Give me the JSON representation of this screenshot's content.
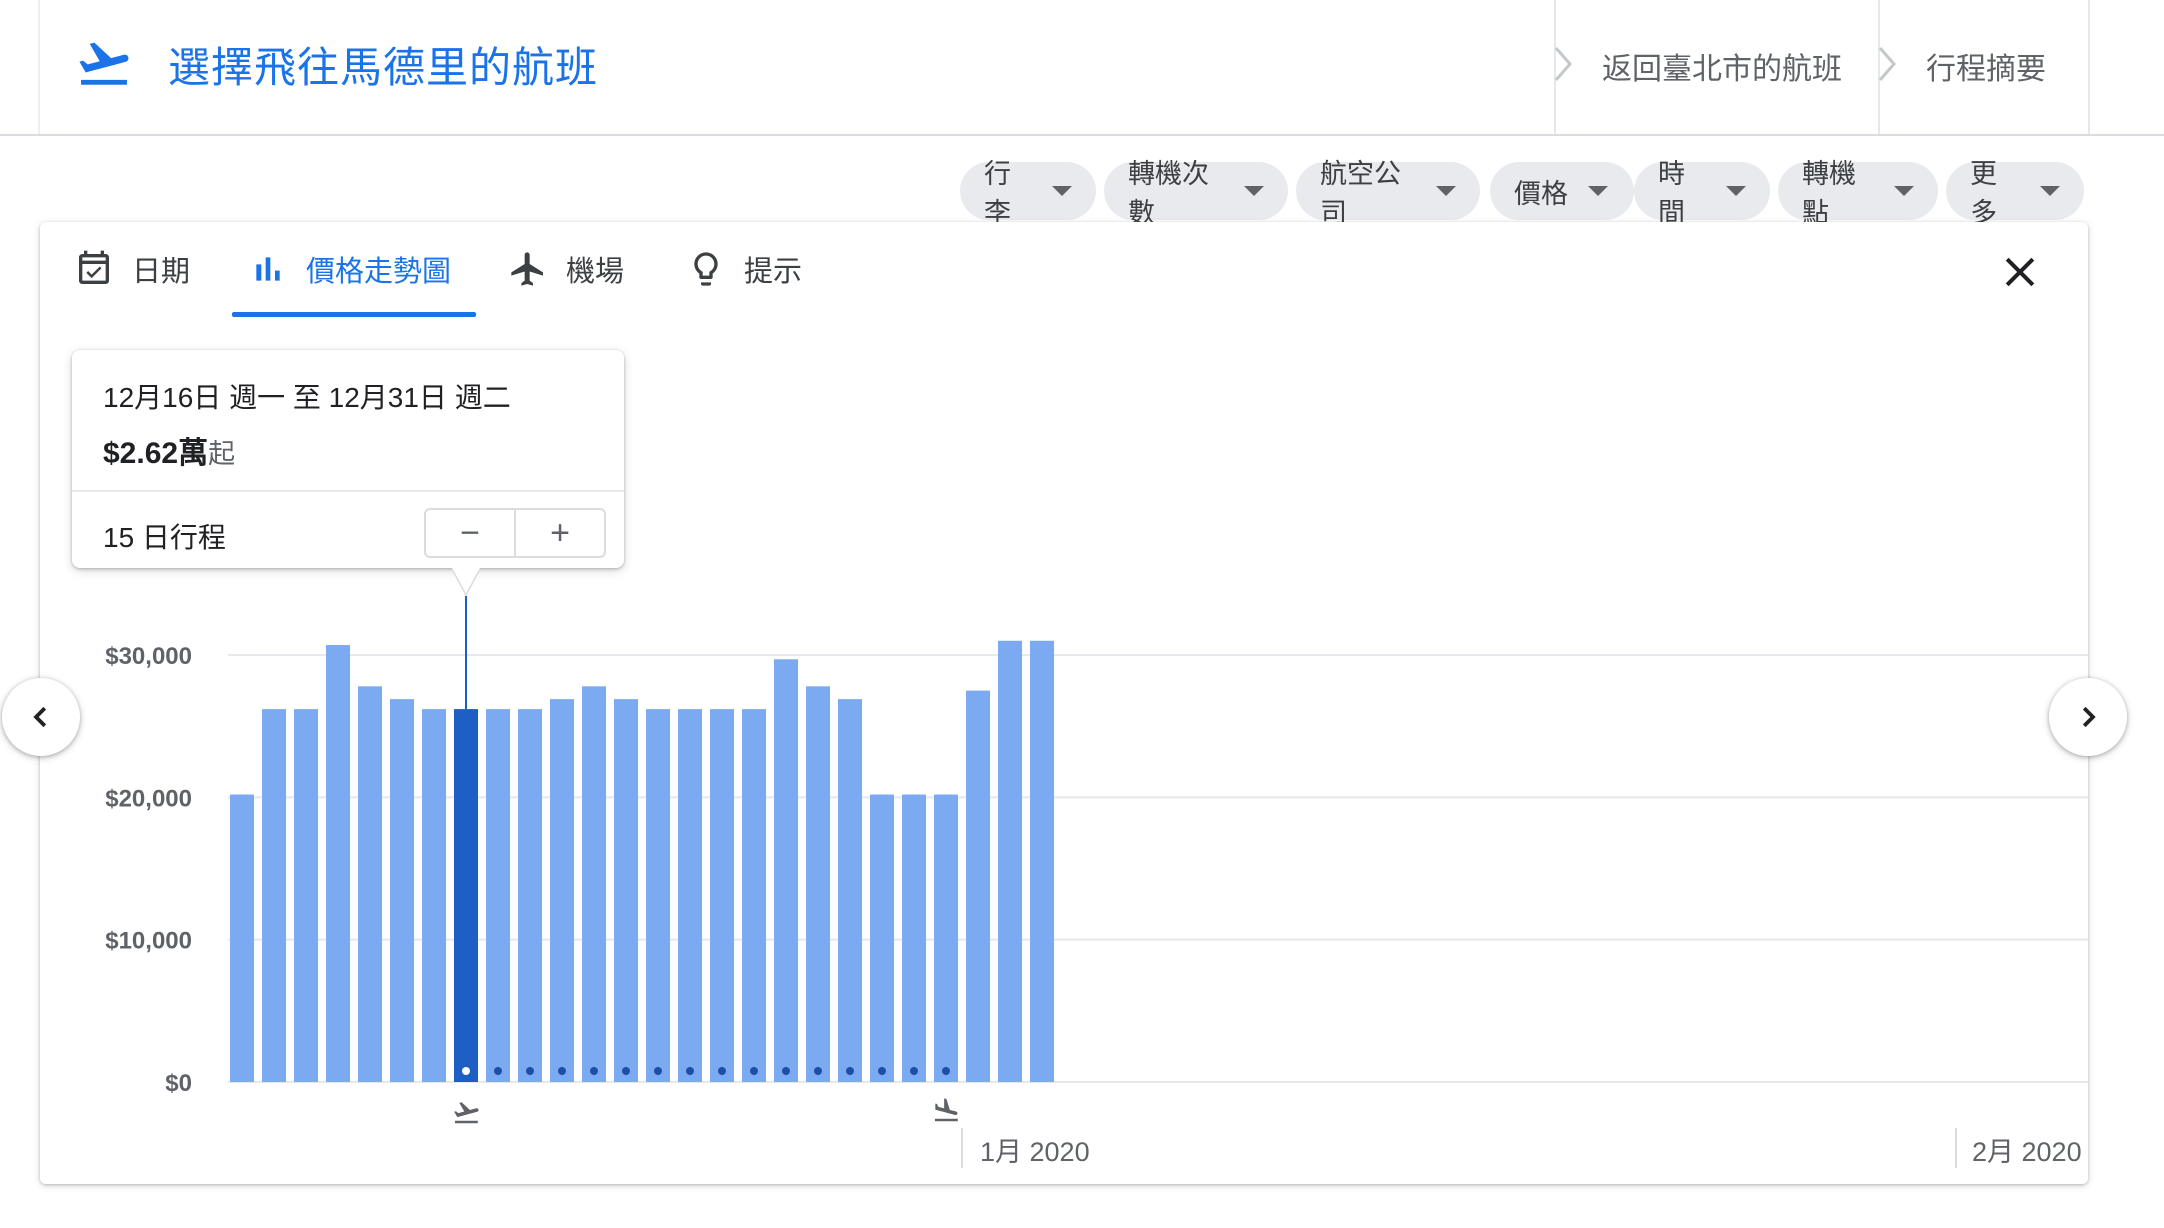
{
  "header": {
    "title": "選擇飛往馬德里的航班",
    "breadcrumbs": [
      "返回臺北市的航班",
      "行程摘要"
    ]
  },
  "filters": [
    {
      "label": "行李"
    },
    {
      "label": "轉機次數"
    },
    {
      "label": "航空公司"
    },
    {
      "label": "價格"
    },
    {
      "label": "時間"
    },
    {
      "label": "轉機點"
    },
    {
      "label": "更多"
    }
  ],
  "tabs": [
    {
      "label": "日期",
      "icon": "calendar-icon"
    },
    {
      "label": "價格走勢圖",
      "icon": "bar-chart-icon",
      "active": true
    },
    {
      "label": "機場",
      "icon": "airplane-icon"
    },
    {
      "label": "提示",
      "icon": "lightbulb-icon"
    }
  ],
  "tooltip": {
    "date_range": "12月16日 週一 至 12月31日 週二",
    "price": "$2.62萬",
    "price_suffix": "起",
    "duration": "15 日行程",
    "minus": "−",
    "plus": "+"
  },
  "colors": {
    "accent": "#1a73e8",
    "bar": "#7baaf0",
    "bar_selected": "#1d5fc4"
  },
  "chart_data": {
    "type": "bar",
    "ylim": [
      0,
      30000
    ],
    "y_ticks": [
      "$0",
      "$10,000",
      "$20,000",
      "$30,000"
    ],
    "y_tick_values": [
      0,
      10000,
      20000,
      30000
    ],
    "x_month_labels": [
      "1月 2020",
      "2月 2020"
    ],
    "values": [
      20200,
      26200,
      26200,
      30700,
      27800,
      26900,
      26200,
      26200,
      26200,
      26200,
      26900,
      27800,
      26900,
      26200,
      26200,
      26200,
      26200,
      29700,
      27800,
      26900,
      20200,
      20200,
      20200,
      27500,
      31000,
      31000
    ],
    "selected_index": 7,
    "trip_range": [
      7,
      22
    ],
    "grid": true
  }
}
